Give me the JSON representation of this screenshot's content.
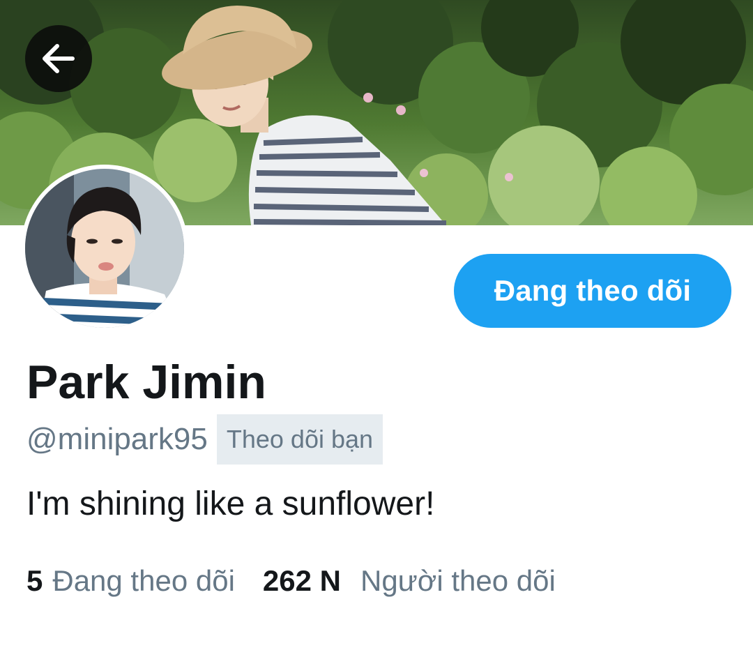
{
  "profile": {
    "display_name": "Park Jimin",
    "handle": "@minipark95",
    "follows_you_label": "Theo dõi bạn",
    "bio": "I'm shining like a sunflower!",
    "follow_button_label": "Đang theo dõi",
    "stats": {
      "following_count": "5",
      "following_label": "Đang theo dõi",
      "followers_count": "262 N",
      "followers_label": "Người theo dõi"
    }
  },
  "icons": {
    "back": "arrow-left-icon"
  },
  "colors": {
    "accent": "#1da1f2",
    "text_primary": "#14171a",
    "text_secondary": "#657786",
    "badge_bg": "#e6ecf0"
  }
}
